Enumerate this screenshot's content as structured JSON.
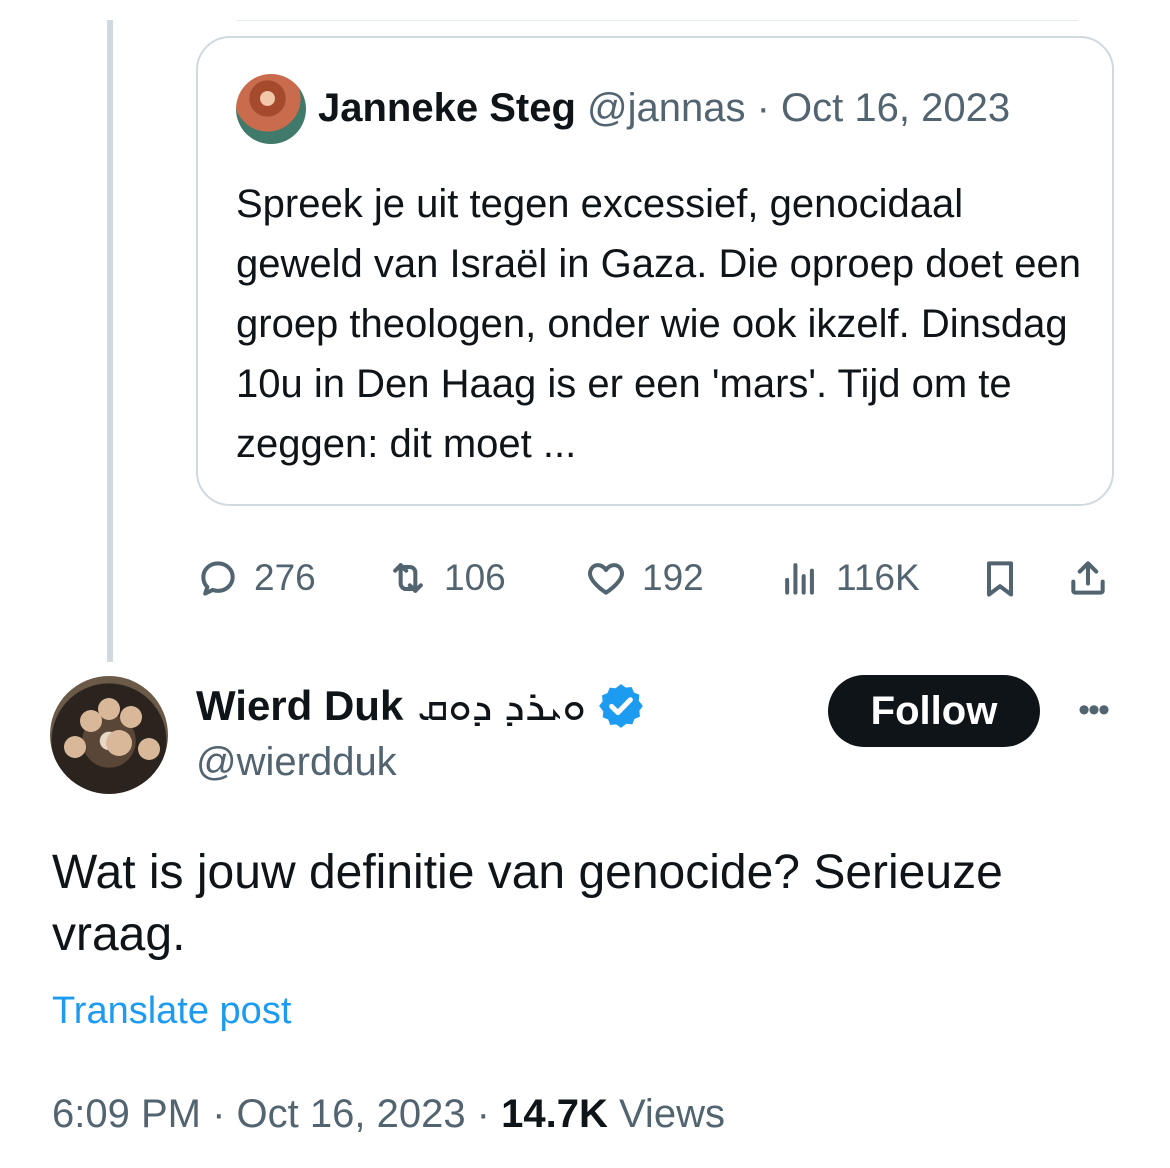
{
  "quoted_tweet": {
    "author_name": "Janneke Steg",
    "author_handle": "@jannas",
    "separator": " · ",
    "date": "Oct 16, 2023",
    "text": "Spreek je uit tegen excessief, genocidaal geweld van Israël in Gaza. Die oproep doet een groep theologen, onder wie ook ikzelf. Dinsdag 10u in Den Haag is er een 'mars'. Tijd om te zeggen: dit moet ..."
  },
  "actions": {
    "reply_count": "276",
    "retweet_count": "106",
    "like_count": "192",
    "view_count": "116K",
    "icons": [
      "reply-icon",
      "retweet-icon",
      "like-icon",
      "views-icon",
      "bookmark-icon",
      "share-icon"
    ]
  },
  "reply": {
    "author_name": "Wierd Duk",
    "name_suffix": "ܘܝܪܕ ܕܘܩ",
    "author_handle": "@wierdduk",
    "verified": true,
    "follow_label": "Follow",
    "more_label": "•••",
    "text": "Wat is jouw definitie van genocide? Serieuze vraag.",
    "translate_label": "Translate post",
    "time": "6:09 PM",
    "separator": " · ",
    "date": "Oct 16, 2023",
    "separator2": " · ",
    "views_count": "14.7K",
    "views_label": " Views"
  },
  "colors": {
    "text": "#0f1419",
    "secondary": "#536471",
    "link": "#1d9bf0",
    "verified": "#1d9bf0",
    "border": "#cfd9de"
  }
}
